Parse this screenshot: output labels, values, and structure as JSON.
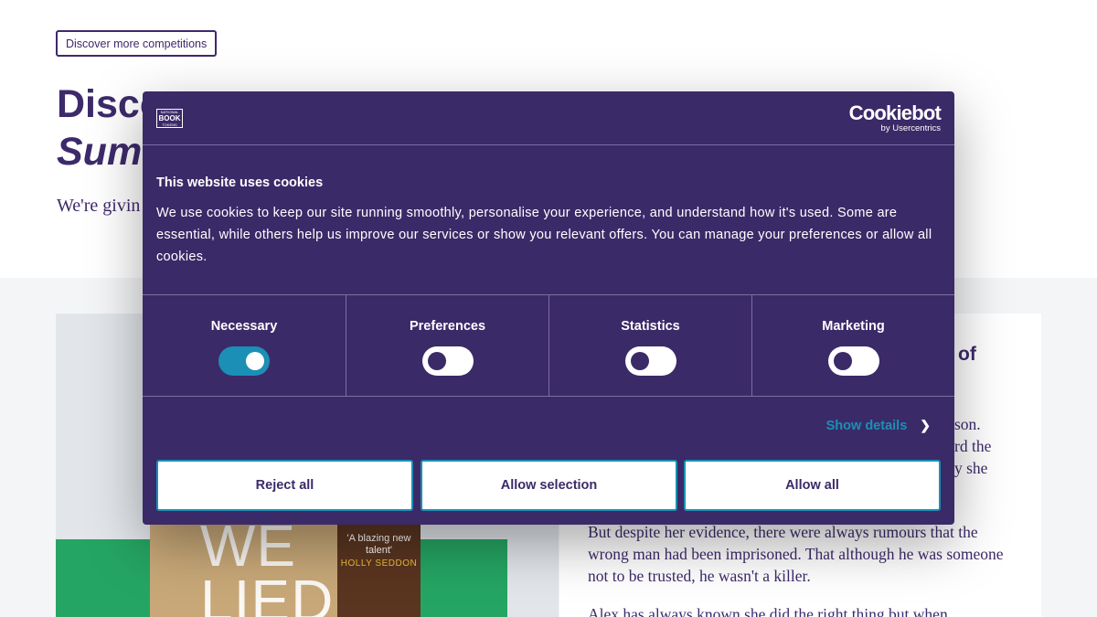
{
  "page": {
    "competitions_link": "Discover more competitions",
    "title_line1": "Disco",
    "title_line2_italic": "Sum",
    "intro": "We're givin",
    "card_heading_fragment": "of",
    "body_fragments": [
      "son.",
      "rd the",
      "y she"
    ],
    "article_paragraphs": [
      "But despite her evidence, there were always rumours that the wrong man had been imprisoned. That although he was someone not to be trusted, he wasn't a killer.",
      "Alex has always known she did the right thing but when"
    ],
    "book_cover": {
      "title": "WE LIED",
      "quote": "'A blazing new talent'",
      "author": "HOLLY SEDDON"
    }
  },
  "cookie_dialog": {
    "logo_text": [
      "NATIONAL",
      "BOOK",
      "TOKENS"
    ],
    "brand": "Cookiebot",
    "brand_sub": "by Usercentrics",
    "title": "This website uses cookies",
    "text": "We use cookies to keep our site running smoothly, personalise your experience, and understand how it's used. Some are essential, while others help us improve our services or show you relevant offers. You can manage your preferences or allow all cookies.",
    "categories": [
      {
        "label": "Necessary",
        "enabled": true
      },
      {
        "label": "Preferences",
        "enabled": false
      },
      {
        "label": "Statistics",
        "enabled": false
      },
      {
        "label": "Marketing",
        "enabled": false
      }
    ],
    "show_details": "Show details",
    "buttons": {
      "reject": "Reject all",
      "selection": "Allow selection",
      "allow": "Allow all"
    },
    "colors": {
      "dialog_bg": "#3b2a68",
      "accent": "#1b8fb5"
    }
  }
}
